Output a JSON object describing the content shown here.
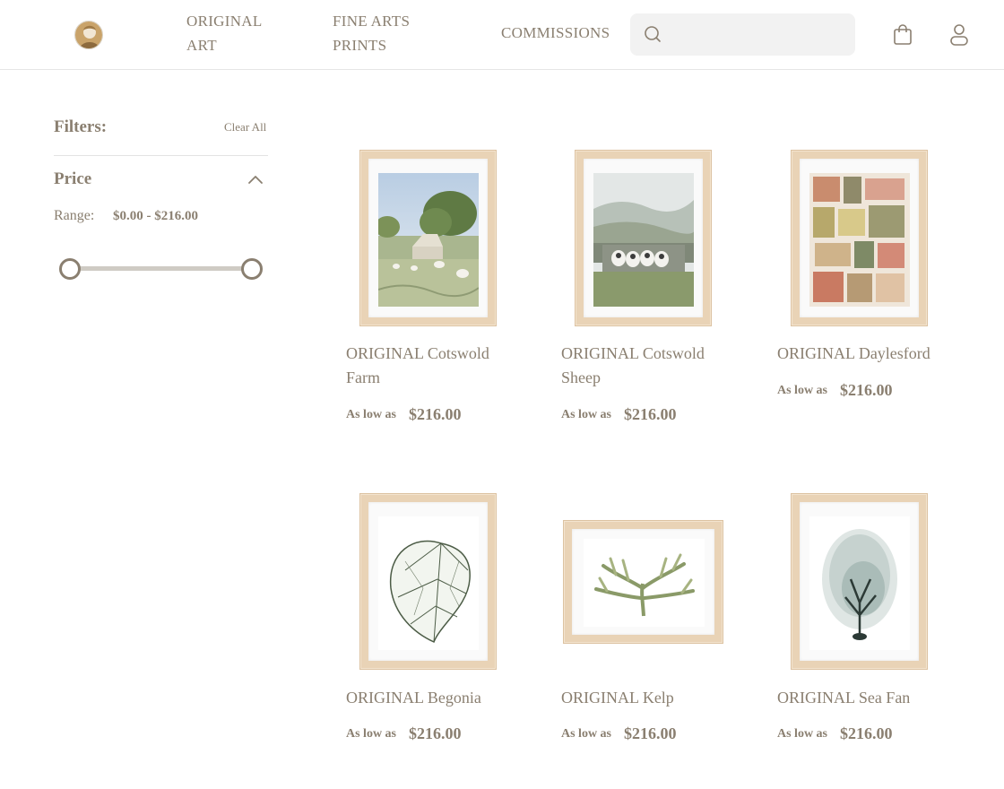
{
  "header": {
    "nav": [
      {
        "label": "ORIGINAL ART"
      },
      {
        "label": "FINE ARTS PRINTS"
      },
      {
        "label": "COMMISSIONS"
      }
    ],
    "search_placeholder": "",
    "icons": {
      "search": "search-icon",
      "cart": "shopping-bag-icon",
      "account": "user-icon"
    }
  },
  "filters": {
    "title": "Filters:",
    "clear_all": "Clear All",
    "price": {
      "title": "Price",
      "range_label": "Range:",
      "range_value": "$0.00 - $216.00",
      "slider_min_fraction": 0,
      "slider_max_fraction": 1
    }
  },
  "products": [
    {
      "title": "ORIGINAL Cotswold Farm",
      "price_label": "As low as",
      "price": "$216.00"
    },
    {
      "title": "ORIGINAL Cotswold Sheep",
      "price_label": "As low as",
      "price": "$216.00"
    },
    {
      "title": "ORIGINAL Daylesford",
      "price_label": "As low as",
      "price": "$216.00"
    },
    {
      "title": "ORIGINAL Begonia",
      "price_label": "As low as",
      "price": "$216.00"
    },
    {
      "title": "ORIGINAL Kelp",
      "price_label": "As low as",
      "price": "$216.00"
    },
    {
      "title": "ORIGINAL Sea Fan",
      "price_label": "As low as",
      "price": "$216.00"
    }
  ],
  "colors": {
    "text": "#8a7f70",
    "frame": "#e9d3b6",
    "search_bg": "#f2f2f2"
  }
}
